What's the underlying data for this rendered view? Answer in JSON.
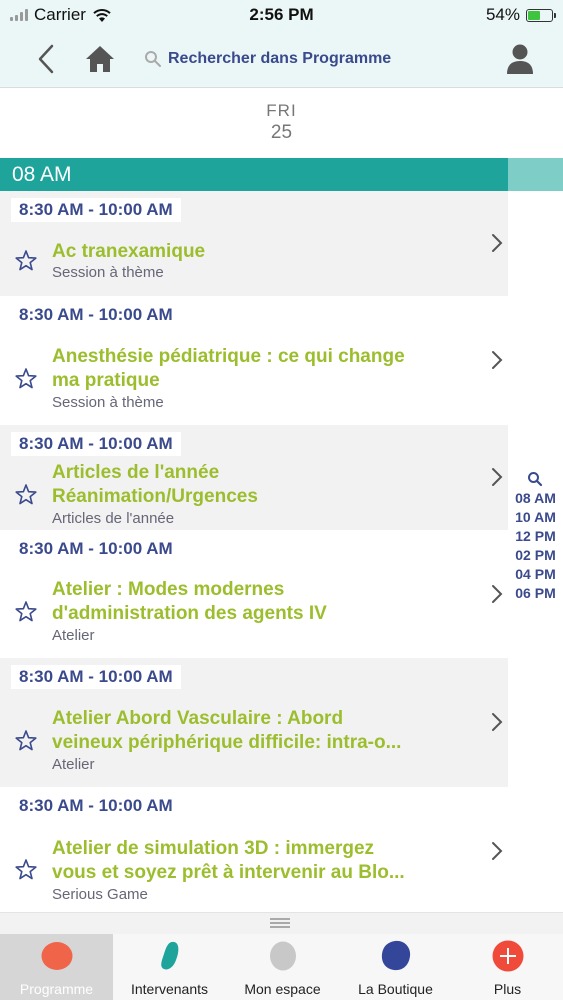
{
  "status_bar": {
    "carrier": "Carrier",
    "time": "2:56 PM",
    "battery": "54%",
    "battery_level": 0.54
  },
  "nav": {
    "search_label": "Rechercher dans Programme"
  },
  "date": {
    "day": "FRI",
    "number": "25"
  },
  "hour_bar": "08 AM",
  "sessions": [
    {
      "time": "8:30 AM - 10:00 AM",
      "title_lines": [
        "Ac tranexamique"
      ],
      "subtitle": "Session à thème"
    },
    {
      "time": "8:30 AM - 10:00 AM",
      "title_lines": [
        "Anesthésie pédiatrique : ce qui change",
        "ma pratique"
      ],
      "subtitle": "Session à thème"
    },
    {
      "time": "8:30 AM - 10:00 AM",
      "title_lines": [
        "Articles de l'année",
        "Réanimation/Urgences"
      ],
      "subtitle": "Articles de l'année"
    },
    {
      "time": "8:30 AM - 10:00 AM",
      "title_lines": [
        "Atelier : Modes modernes",
        "d'administration des agents IV"
      ],
      "subtitle": "Atelier"
    },
    {
      "time": "8:30 AM - 10:00 AM",
      "title_lines": [
        "Atelier Abord Vasculaire : Abord",
        "veineux périphérique difficile: intra-o..."
      ],
      "subtitle": "Atelier"
    },
    {
      "time": "8:30 AM - 10:00 AM",
      "title_lines": [
        "Atelier de simulation 3D : immergez",
        "vous et soyez prêt à intervenir au Blo..."
      ],
      "subtitle": "Serious Game"
    }
  ],
  "time_index": [
    "08 AM",
    "10 AM",
    "12 PM",
    "02 PM",
    "04 PM",
    "06 PM"
  ],
  "tabs": [
    {
      "label": "Programme",
      "color": "#f0644a",
      "active": true
    },
    {
      "label": "Intervenants",
      "color": "#1ea49b",
      "active": false
    },
    {
      "label": "Mon espace",
      "color": "#c8c8c8",
      "active": false
    },
    {
      "label": "La Boutique",
      "color": "#34469a",
      "active": false
    },
    {
      "label": "Plus",
      "color": "#ef4a3a",
      "active": false
    }
  ],
  "colors": {
    "accent_teal": "#1ea49b",
    "title_green": "#9cbe2e",
    "navy": "#3a4a8c"
  }
}
